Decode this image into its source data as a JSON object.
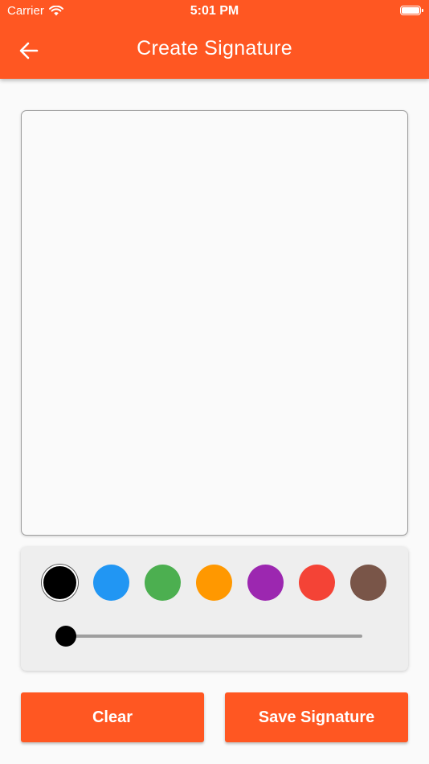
{
  "status_bar": {
    "carrier": "Carrier",
    "time": "5:01 PM"
  },
  "header": {
    "title": "Create Signature",
    "back_icon": "arrow-left-icon"
  },
  "palette": {
    "colors": [
      "#000000",
      "#2196f3",
      "#4caf50",
      "#ff9800",
      "#9c27b0",
      "#f44336",
      "#795548"
    ],
    "selected_index": 0
  },
  "stroke_width": {
    "value": 0,
    "min": 0,
    "max": 1
  },
  "buttons": {
    "clear_label": "Clear",
    "save_label": "Save Signature"
  },
  "theme": {
    "primary": "#ff5722"
  }
}
